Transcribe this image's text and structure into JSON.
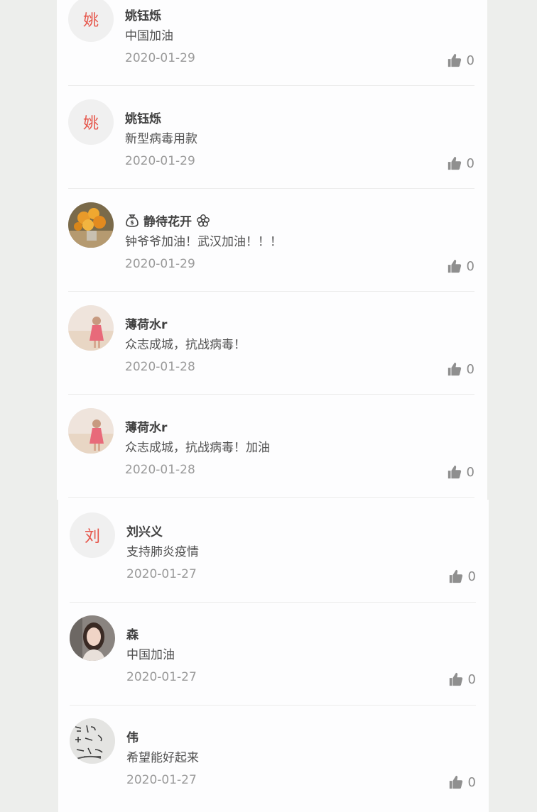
{
  "comments": [
    {
      "initial": "姚",
      "name": "姚钰烁",
      "content": "中国加油",
      "date": "2020-01-29",
      "likes": "0"
    },
    {
      "initial": "姚",
      "name": "姚钰烁",
      "content": "新型病毒用款",
      "date": "2020-01-29",
      "likes": "0"
    },
    {
      "initial": "",
      "name": "静待花开",
      "content": "钟爷爷加油！武汉加油！！！",
      "date": "2020-01-29",
      "likes": "0"
    },
    {
      "initial": "",
      "name": "薄荷水r",
      "content": "众志成城，抗战病毒！",
      "date": "2020-01-28",
      "likes": "0"
    },
    {
      "initial": "",
      "name": "薄荷水r",
      "content": "众志成城，抗战病毒！加油",
      "date": "2020-01-28",
      "likes": "0"
    },
    {
      "initial": "刘",
      "name": "刘兴义",
      "content": "支持肺炎疫情",
      "date": "2020-01-27",
      "likes": "0"
    },
    {
      "initial": "",
      "name": "森",
      "content": "中国加油",
      "date": "2020-01-27",
      "likes": "0"
    },
    {
      "initial": "",
      "name": "伟",
      "content": "希望能好起来",
      "date": "2020-01-27",
      "likes": "0"
    }
  ]
}
